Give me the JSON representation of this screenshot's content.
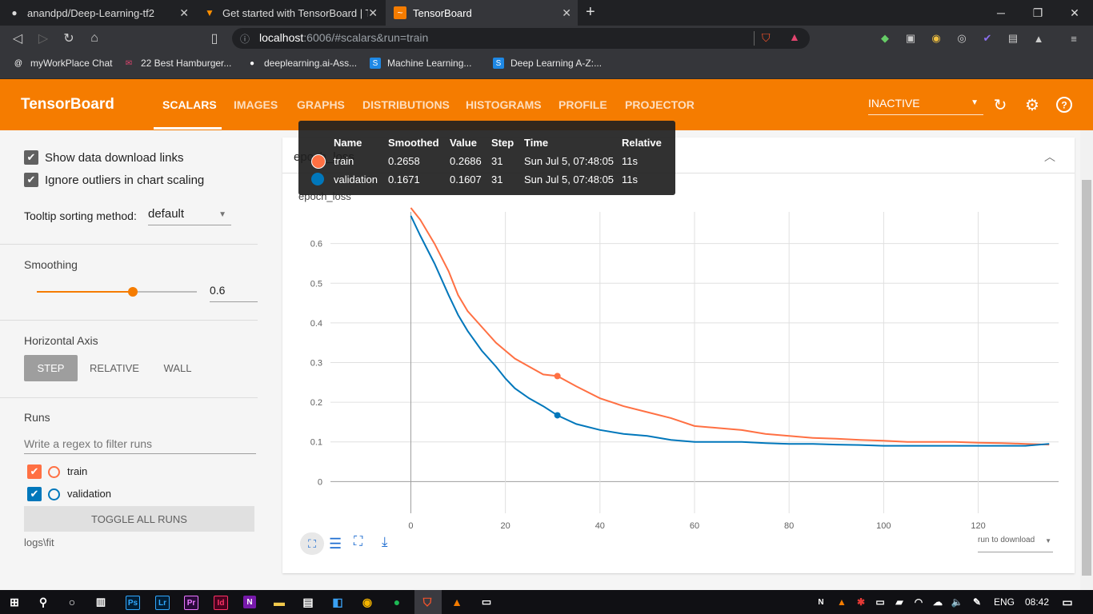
{
  "browser": {
    "tabs": [
      {
        "title": "anandpd/Deep-Learning-tf2",
        "icon": "github-icon"
      },
      {
        "title": "Get started with TensorBoard  |  Te",
        "icon": "tensorflow-icon"
      },
      {
        "title": "TensorBoard",
        "icon": "tensorboard-icon",
        "active": true
      }
    ],
    "new_tab": "+",
    "url_host": "localhost",
    "url_rest": ":6006/#scalars&run=train",
    "bookmarks": [
      {
        "label": "myWorkPlace Chat",
        "icon": "workplace-icon"
      },
      {
        "label": "22 Best Hamburger...",
        "icon": "mail-icon"
      },
      {
        "label": "deeplearning.ai-Ass...",
        "icon": "github-icon"
      },
      {
        "label": "Machine Learning...",
        "icon": "s-icon"
      },
      {
        "label": "Deep Learning A-Z:...",
        "icon": "s-icon"
      }
    ]
  },
  "header": {
    "title": "TensorBoard",
    "tabs": [
      "SCALARS",
      "IMAGES",
      "GRAPHS",
      "DISTRIBUTIONS",
      "HISTOGRAMS",
      "PROFILE",
      "PROJECTOR"
    ],
    "active_tab": "SCALARS",
    "status": "INACTIVE"
  },
  "sidebar": {
    "show_download": "Show data download links",
    "ignore_outliers": "Ignore outliers in chart scaling",
    "tooltip_sorting_label": "Tooltip sorting method:",
    "tooltip_sorting_value": "default",
    "smoothing_label": "Smoothing",
    "smoothing_value": "0.6",
    "smoothing_level": 0.6,
    "horizontal_axis_label": "Horizontal Axis",
    "axis_options": [
      "STEP",
      "RELATIVE",
      "WALL"
    ],
    "axis_selected": "STEP",
    "runs_label": "Runs",
    "filter_placeholder": "Write a regex to filter runs",
    "runs": [
      {
        "name": "train",
        "color": "#ff7043",
        "checked": true
      },
      {
        "name": "validation",
        "color": "#0077bb",
        "checked": true
      }
    ],
    "toggle_all": "TOGGLE ALL RUNS",
    "logdir": "logs\\fit"
  },
  "card": {
    "title": "epoch_loss",
    "subtitle": "epoch_loss",
    "run_to_download": "run to download"
  },
  "tooltip": {
    "headers": [
      "Name",
      "Smoothed",
      "Value",
      "Step",
      "Time",
      "Relative"
    ],
    "rows": [
      {
        "name": "train",
        "smoothed": "0.2658",
        "value": "0.2686",
        "step": "31",
        "time": "Sun Jul 5, 07:48:05",
        "relative": "11s",
        "color": "#ff7043"
      },
      {
        "name": "validation",
        "smoothed": "0.1671",
        "value": "0.1607",
        "step": "31",
        "time": "Sun Jul 5, 07:48:05",
        "relative": "11s",
        "color": "#0077bb"
      }
    ]
  },
  "chart_data": {
    "type": "line",
    "title": "epoch_loss",
    "xlabel": "",
    "ylabel": "",
    "xlim": [
      -17,
      137
    ],
    "ylim": [
      -0.08,
      0.68
    ],
    "xticks": [
      "0",
      "20",
      "40",
      "60",
      "80",
      "100",
      "120"
    ],
    "yticks": [
      "0",
      "0.1",
      "0.2",
      "0.3",
      "0.4",
      "0.5",
      "0.6"
    ],
    "x": [
      0,
      2,
      5,
      8,
      10,
      12,
      15,
      18,
      20,
      22,
      25,
      28,
      31,
      35,
      40,
      45,
      50,
      55,
      60,
      65,
      70,
      75,
      80,
      85,
      90,
      95,
      100,
      105,
      110,
      115,
      120,
      125,
      130,
      135
    ],
    "series": [
      {
        "name": "train",
        "color": "#ff7043",
        "values": [
          0.69,
          0.66,
          0.6,
          0.53,
          0.47,
          0.43,
          0.39,
          0.35,
          0.33,
          0.31,
          0.29,
          0.27,
          0.266,
          0.24,
          0.21,
          0.19,
          0.175,
          0.16,
          0.14,
          0.135,
          0.13,
          0.12,
          0.115,
          0.11,
          0.108,
          0.105,
          0.103,
          0.1,
          0.1,
          0.1,
          0.098,
          0.097,
          0.095,
          0.093
        ]
      },
      {
        "name": "validation",
        "color": "#0077bb",
        "values": [
          0.67,
          0.62,
          0.55,
          0.47,
          0.42,
          0.38,
          0.33,
          0.29,
          0.26,
          0.235,
          0.21,
          0.19,
          0.167,
          0.145,
          0.13,
          0.12,
          0.115,
          0.105,
          0.1,
          0.1,
          0.1,
          0.097,
          0.095,
          0.095,
          0.093,
          0.092,
          0.09,
          0.09,
          0.09,
          0.09,
          0.09,
          0.09,
          0.09,
          0.095
        ]
      }
    ],
    "hover_step": 31,
    "grid": true,
    "legend": "none"
  },
  "taskbar": {
    "time": "08:42",
    "lang": "ENG",
    "apps": [
      "Ps",
      "Lr",
      "Pr",
      "Id",
      "N"
    ]
  }
}
